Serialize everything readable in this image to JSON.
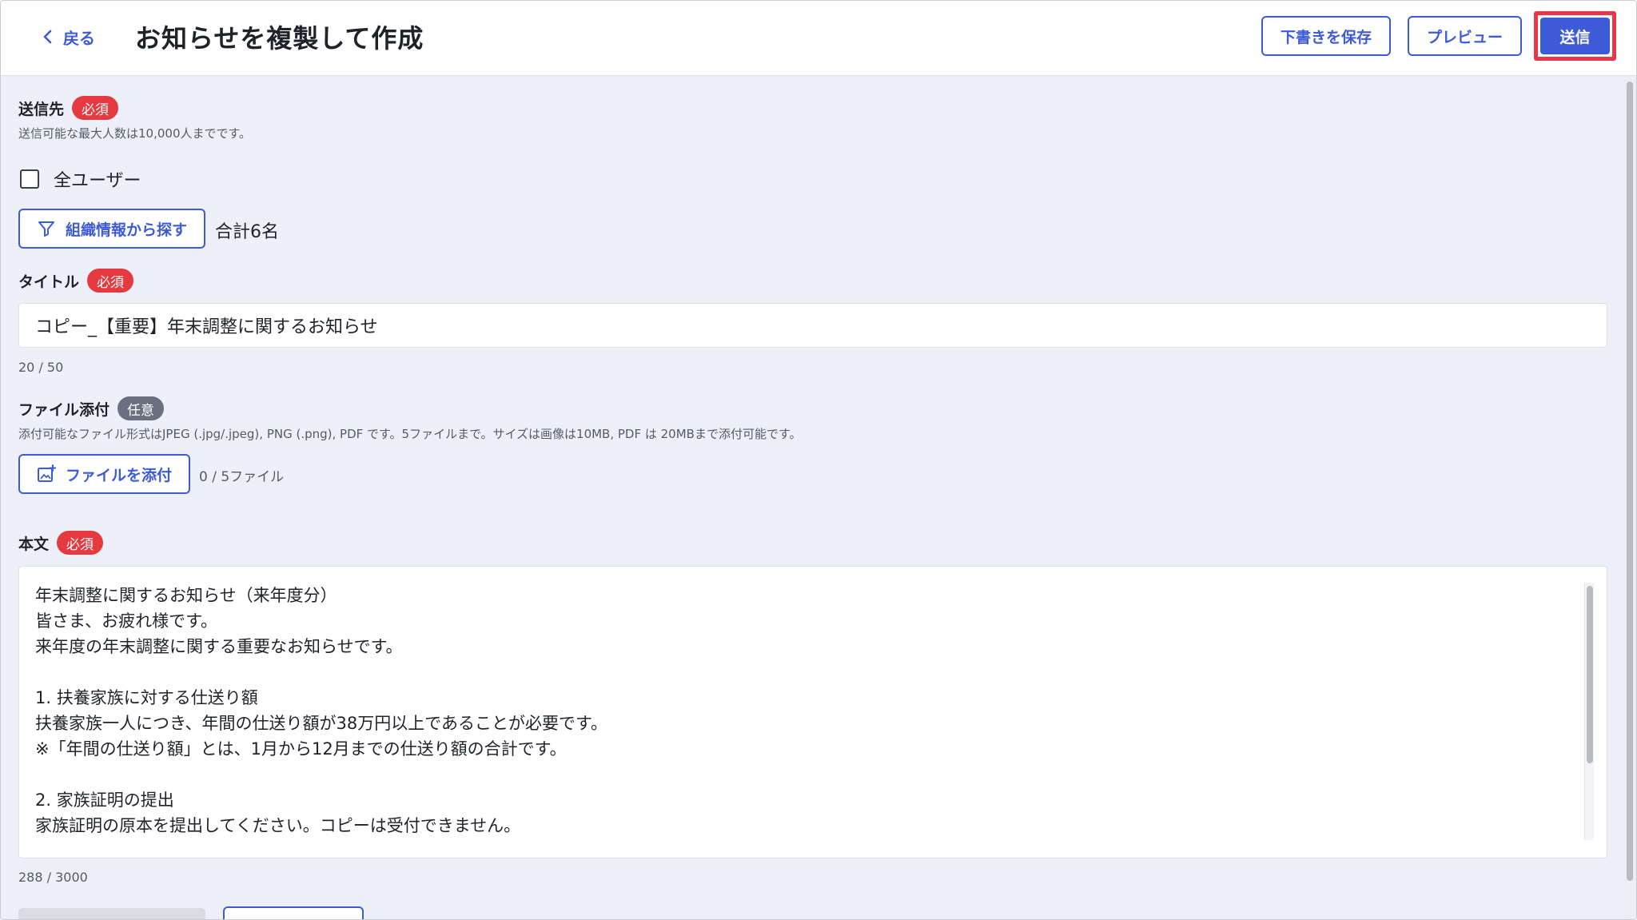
{
  "header": {
    "back_label": "戻る",
    "title": "お知らせを複製して作成",
    "save_draft_label": "下書きを保存",
    "preview_label": "プレビュー",
    "send_label": "送信"
  },
  "recipients": {
    "label": "送信先",
    "badge": "必須",
    "hint": "送信可能な最大人数は10,000人までです。",
    "all_users_label": "全ユーザー",
    "all_users_checked": false,
    "org_search_label": "組織情報から探す",
    "total": "合計6名"
  },
  "title_field": {
    "label": "タイトル",
    "badge": "必須",
    "value": "コピー_【重要】年末調整に関するお知らせ",
    "counter": "20 / 50"
  },
  "attachment": {
    "label": "ファイル添付",
    "badge": "任意",
    "hint": "添付可能なファイル形式はJPEG (.jpg/.jpeg), PNG (.png), PDF です。5ファイルまで。サイズは画像は10MB, PDF は 20MBまで添付可能です。",
    "button_label": "ファイルを添付",
    "count": "0 / 5ファイル"
  },
  "body_field": {
    "label": "本文",
    "badge": "必須",
    "lines": [
      "年末調整に関するお知らせ（来年度分）",
      "皆さま、お疲れ様です。",
      "来年度の年末調整に関する重要なお知らせです。",
      "",
      "1. 扶養家族に対する仕送り額",
      "扶養家族一人につき、年間の仕送り額が38万円以上であることが必要です。",
      "※「年間の仕送り額」とは、1月から12月までの仕送り額の合計です。",
      "",
      "2. 家族証明の提出",
      "家族証明の原本を提出してください。コピーは受付できません。"
    ],
    "counter": "288 / 3000"
  },
  "colors": {
    "accent": "#3d5bd9",
    "required": "#e53a3f",
    "optional": "#6b7080",
    "highlight": "#e8364a",
    "background": "#edf0f8"
  }
}
